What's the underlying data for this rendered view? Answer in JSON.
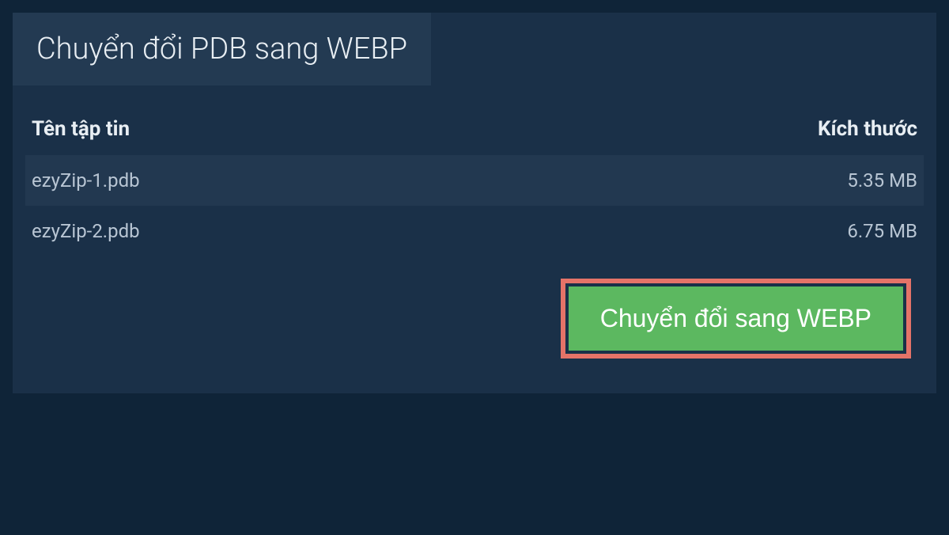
{
  "tab": {
    "title": "Chuyển đổi PDB sang WEBP"
  },
  "table": {
    "headers": {
      "filename": "Tên tập tin",
      "size": "Kích thước"
    },
    "rows": [
      {
        "filename": "ezyZip-1.pdb",
        "size": "5.35 MB"
      },
      {
        "filename": "ezyZip-2.pdb",
        "size": "6.75 MB"
      }
    ]
  },
  "actions": {
    "convert_label": "Chuyển đổi sang WEBP"
  }
}
